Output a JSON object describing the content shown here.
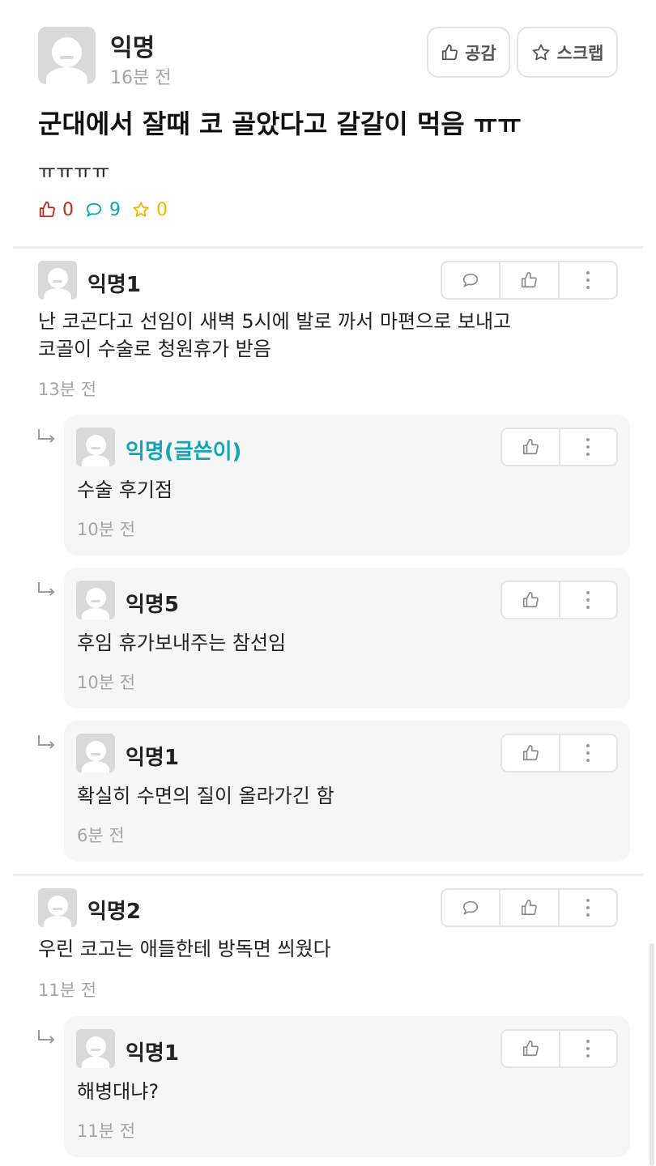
{
  "post": {
    "author": "익명",
    "time": "16분 전",
    "like_button_label": "공감",
    "scrap_button_label": "스크랩",
    "title": "군대에서 잘때 코 골았다고 갈갈이 먹음 ㅠㅠ",
    "body": "ㅠㅠㅠㅠ",
    "stats": {
      "likes": "0",
      "comments": "9",
      "scraps": "0"
    },
    "colors": {
      "likes": "#c62917",
      "comments": "#0ca5b0",
      "scraps": "#f2b600",
      "author_reply": "#12a6b4"
    }
  },
  "comments": [
    {
      "author": "익명1",
      "text_lines": [
        "난 코곤다고 선임이 새벽 5시에 발로 까서 마편으로 보내고",
        "코골이 수술로 청원휴가 받음"
      ],
      "time": "13분 전",
      "replies": [
        {
          "author": "익명(글쓴이)",
          "text": "수술 후기점",
          "time": "10분 전"
        },
        {
          "author": "익명5",
          "text": "후임 휴가보내주는 참선임",
          "time": "10분 전"
        },
        {
          "author": "익명1",
          "text": "확실히 수면의 질이 올라가긴 함",
          "time": "6분 전"
        }
      ]
    },
    {
      "author": "익명2",
      "text_lines": [
        "우린 코고는 애들한테 방독면 씌웠다"
      ],
      "time": "11분 전",
      "replies": [
        {
          "author": "익명1",
          "text": "해병대냐?",
          "time": "11분 전"
        }
      ]
    }
  ],
  "icons": {
    "thumbs_up": "thumbs-up-icon",
    "speech_bubble": "comment-icon",
    "star": "star-icon",
    "more": "more-vertical-icon",
    "reply_arrow": "reply-arrow-icon",
    "avatar": "anonymous-avatar-icon"
  }
}
